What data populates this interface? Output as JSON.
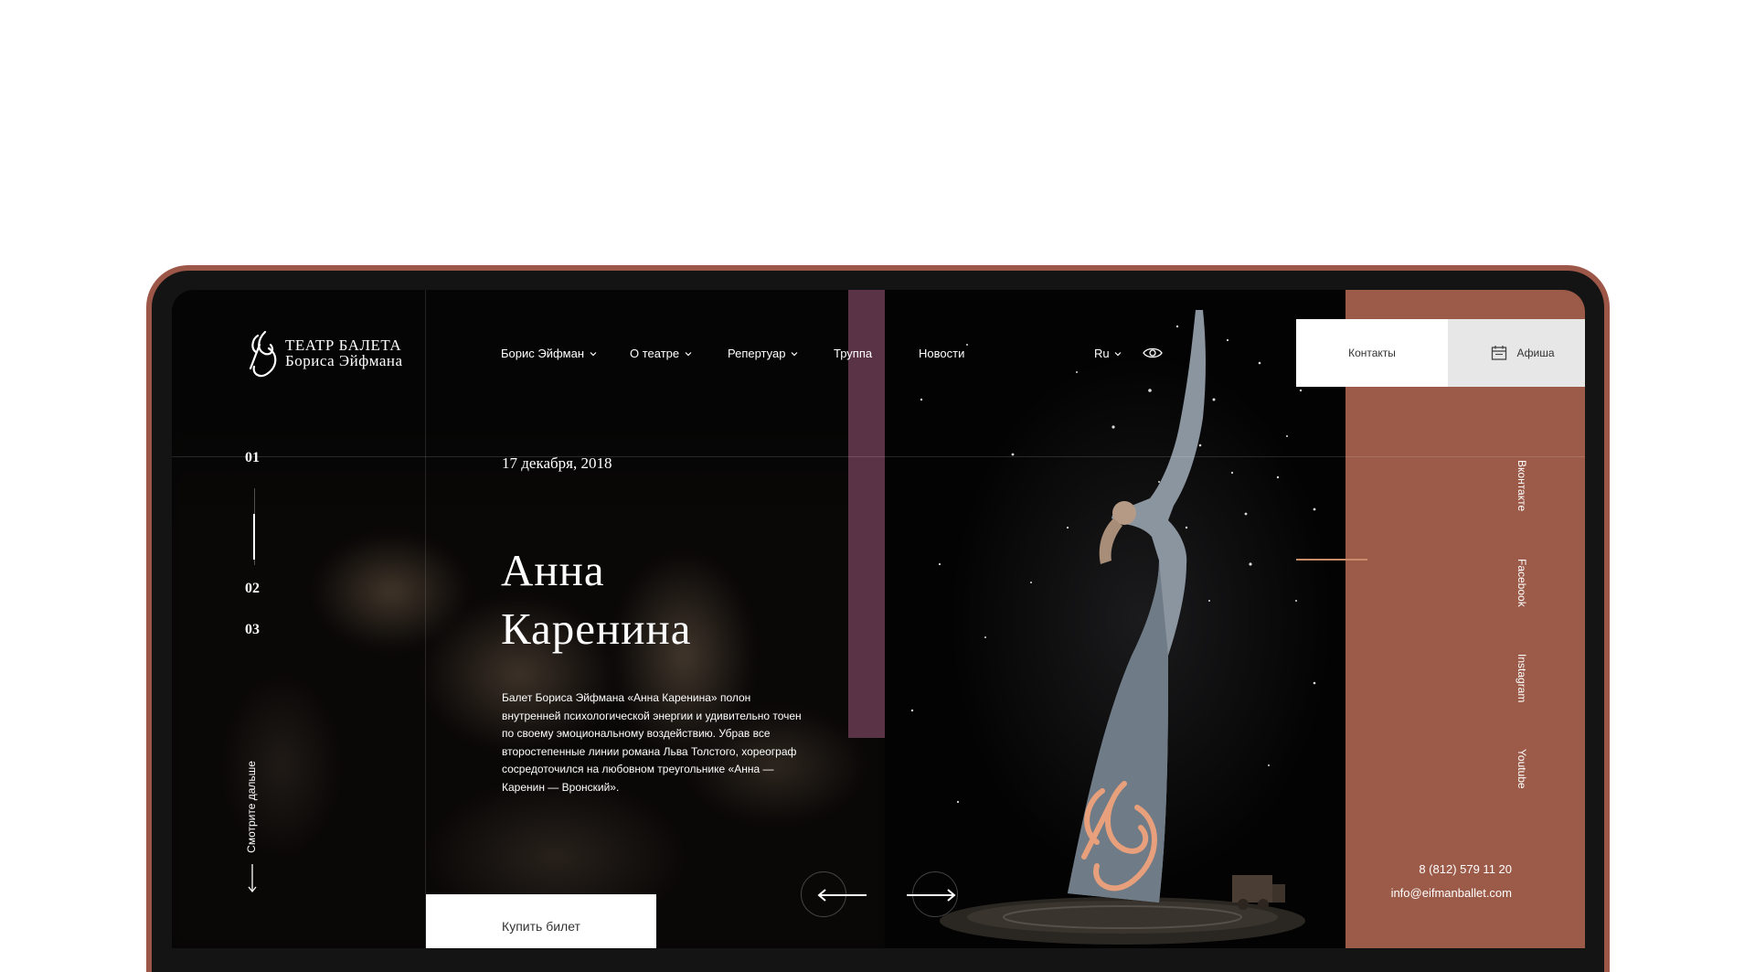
{
  "logo": {
    "line1": "ТЕАТР БАЛЕТА",
    "line2": "Бориса Эйфмана"
  },
  "nav": {
    "items": [
      {
        "label": "Борис Эйфман",
        "dropdown": true
      },
      {
        "label": "О театре",
        "dropdown": true
      },
      {
        "label": "Репертуар",
        "dropdown": true
      },
      {
        "label": "Труппа",
        "dropdown": false
      },
      {
        "label": "Новости",
        "dropdown": false
      }
    ],
    "lang": "Ru",
    "accessibility_icon": "eye-icon"
  },
  "header_buttons": {
    "contacts": "Контакты",
    "afisha": "Афиша",
    "afisha_icon": "calendar-icon"
  },
  "slider": {
    "numbers": [
      "01",
      "02",
      "03"
    ],
    "active": "01",
    "scroll_hint": "Смотрите дальше"
  },
  "slide": {
    "date": "17 декабря, 2018",
    "title_line1": "Анна",
    "title_line2": "Каренина",
    "description": "Балет Бориса Эйфмана «Анна Каренина» полон внутренней психологической энергии и удивительно точен по своему эмоциональному воздействию. Убрав все второстепенные линии романа Льва Толстого, хореограф сосредоточился на любовном треугольнике «Анна — Каренин — Вронский».",
    "buy_button": "Купить билет"
  },
  "social": [
    "Вконтакте",
    "Facebook",
    "Instagram",
    "Youtube"
  ],
  "contacts": {
    "phone": "8 (812) 579 11 20",
    "email": "info@eifmanballet.com"
  },
  "colors": {
    "accent_brown": "#9c5a48",
    "purple_bar": "#5a3347",
    "device_frame": "#9c5748",
    "emblem_orange": "#e8a07c"
  }
}
